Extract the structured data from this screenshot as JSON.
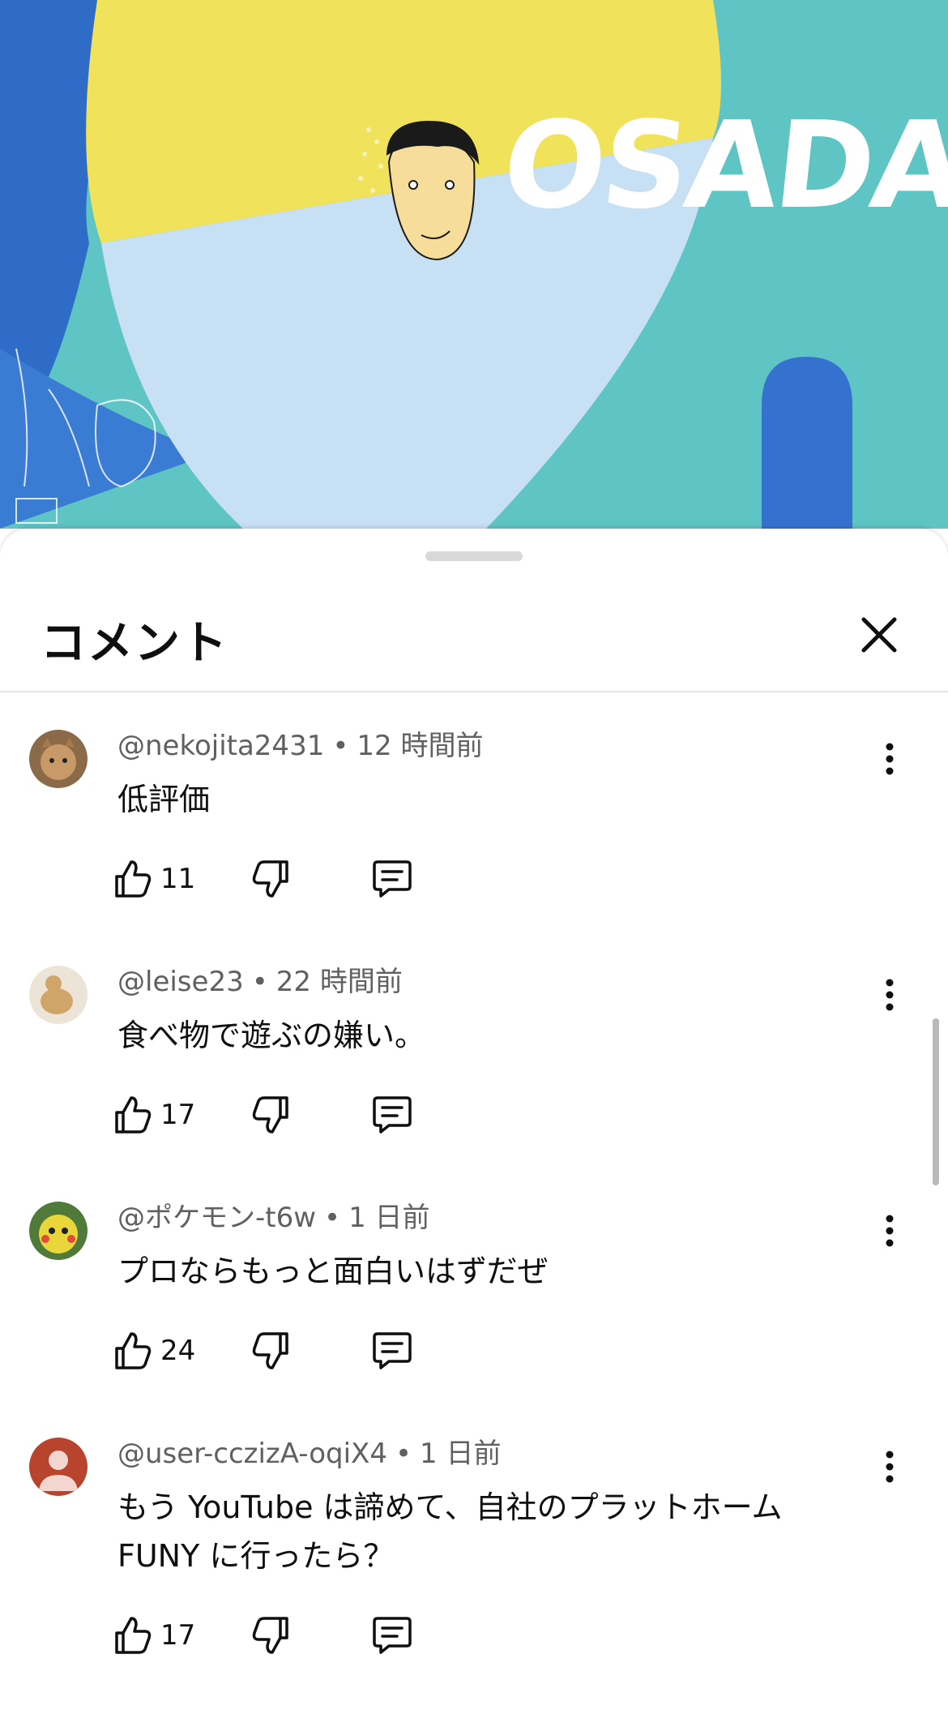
{
  "video": {
    "title_overlay": "OSADA"
  },
  "sheet": {
    "title": "コメント"
  },
  "comments": [
    {
      "author": "@nekojita2431",
      "time": "12 時間前",
      "text": "低評価",
      "likes": "11",
      "avatar_color": "#8a6a48"
    },
    {
      "author": "@leise23",
      "time": "22 時間前",
      "text": "食べ物で遊ぶの嫌い。",
      "likes": "17",
      "avatar_color": "#cfa56a"
    },
    {
      "author": "@ポケモン-t6w",
      "time": "1 日前",
      "text": "プロならもっと面白いはずだぜ",
      "likes": "24",
      "avatar_color": "#e8d63a"
    },
    {
      "author": "@user-cczizA-oqiX4",
      "time": "1 日前",
      "text": "もう YouTube は諦めて、自社のプラットホーム FUNY に行ったら？",
      "likes": "17",
      "avatar_color": "#b8442e"
    }
  ],
  "colors": {
    "video_teal": "#5fc4c4",
    "video_yellow": "#f1e25c",
    "video_lightblue": "#c8e0f4",
    "video_blue": "#3572d0",
    "text_secondary": "#606060"
  },
  "icons": {
    "close": "close-icon",
    "like": "thumbs-up-icon",
    "dislike": "thumbs-down-icon",
    "reply": "comment-reply-icon",
    "menu": "more-vertical-icon"
  }
}
